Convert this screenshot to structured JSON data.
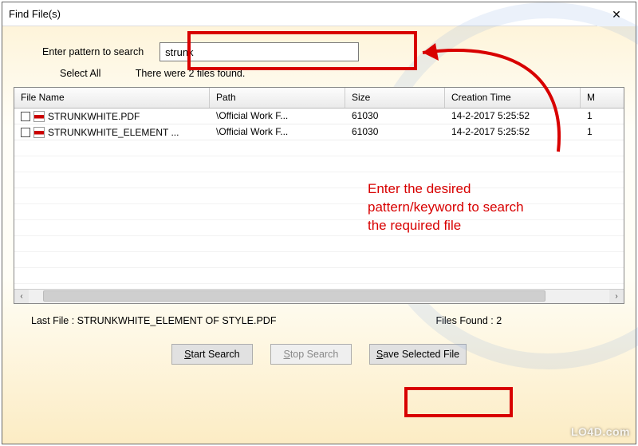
{
  "window": {
    "title": "Find File(s)",
    "close_glyph": "✕"
  },
  "search": {
    "enter_label": "Enter pattern to search",
    "value": "strunk",
    "select_all": "Select All",
    "status": "There were 2 files found."
  },
  "columns": {
    "file_name": "File Name",
    "path": "Path",
    "size": "Size",
    "creation_time": "Creation Time",
    "last": "M"
  },
  "rows": [
    {
      "file_name": "STRUNKWHITE.PDF",
      "path": "\\Official Work F...",
      "size": "61030",
      "creation_time": "14-2-2017 5:25:52",
      "last": "1"
    },
    {
      "file_name": "STRUNKWHITE_ELEMENT ...",
      "path": "\\Official Work F...",
      "size": "61030",
      "creation_time": "14-2-2017 5:25:52",
      "last": "1"
    }
  ],
  "footer": {
    "last_file_label": "Last File  :  STRUNKWHITE_ELEMENT OF STYLE.PDF",
    "files_found_label": "Files Found  :     2"
  },
  "buttons": {
    "start": {
      "pre": "S",
      "rest": "tart Search"
    },
    "stop": {
      "pre": "S",
      "rest": "top Search"
    },
    "save": {
      "pre": "S",
      "rest": "ave Selected File"
    }
  },
  "annotation": {
    "text": "Enter the desired pattern/keyword to search the required file"
  },
  "watermark": "LO4D.com",
  "colors": {
    "accent_red": "#d80000"
  }
}
